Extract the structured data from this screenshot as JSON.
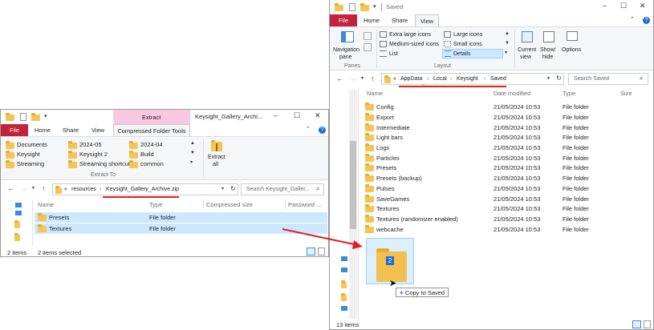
{
  "left_window": {
    "title": "Keysight_Gallery_Archi...",
    "context_tab_group": "Extract",
    "tabs": [
      "File",
      "Home",
      "Share",
      "View",
      "Compressed Folder Tools"
    ],
    "extract_to_label": "Extract To",
    "destinations": [
      [
        "Documents",
        "Keysight",
        "Streaming"
      ],
      [
        "2024-05",
        "Keysight 2",
        "Streaming shortcuts"
      ],
      [
        "2024-04",
        "Build",
        "common"
      ]
    ],
    "extract_all_label_1": "Extract",
    "extract_all_label_2": "all",
    "address": {
      "overflow": "«",
      "crumbs": [
        "resources",
        "Keysight_Gallery_Archive.zip"
      ]
    },
    "search_placeholder": "Search Keysight_Galler...",
    "columns": [
      "Name",
      "Type",
      "Compressed size",
      "Password ..."
    ],
    "rows": [
      {
        "name": "Presets",
        "type": "File folder"
      },
      {
        "name": "Textures",
        "type": "File folder"
      }
    ],
    "status_items": "2 items",
    "status_selected": "2 items selected"
  },
  "right_window": {
    "title": "Saved",
    "tabs": [
      "File",
      "Home",
      "Share",
      "View"
    ],
    "panes": {
      "nav_pane_1": "Navigation",
      "nav_pane_2": "pane",
      "group_label": "Panes"
    },
    "layout": {
      "options": [
        "Extra large icons",
        "Large icons",
        "Medium-sized icons",
        "Small icons",
        "List",
        "Details"
      ],
      "selected": "Details",
      "group_label": "Layout"
    },
    "current_view_1": "Current",
    "current_view_2": "view",
    "show_hide_1": "Show/",
    "show_hide_2": "hide",
    "options_label": "Options",
    "address": {
      "overflow": "«",
      "crumbs": [
        "AppData",
        "Local",
        "Keysight",
        "Saved"
      ]
    },
    "search_placeholder": "Search Saved",
    "columns": [
      "Name",
      "Date modified",
      "Type",
      "Size"
    ],
    "rows": [
      {
        "name": "Config",
        "date": "21/05/2024 10:53",
        "type": "File folder"
      },
      {
        "name": "Export",
        "date": "21/05/2024 10:53",
        "type": "File folder"
      },
      {
        "name": "Intermediate",
        "date": "21/05/2024 10:53",
        "type": "File folder"
      },
      {
        "name": "Light bars",
        "date": "21/05/2024 10:53",
        "type": "File folder"
      },
      {
        "name": "Logs",
        "date": "21/05/2024 10:53",
        "type": "File folder"
      },
      {
        "name": "Particles",
        "date": "21/05/2024 10:53",
        "type": "File folder"
      },
      {
        "name": "Presets",
        "date": "21/05/2024 10:53",
        "type": "File folder"
      },
      {
        "name": "Presets (backup)",
        "date": "21/05/2024 10:53",
        "type": "File folder"
      },
      {
        "name": "Pulses",
        "date": "21/05/2024 10:53",
        "type": "File folder"
      },
      {
        "name": "SaveGames",
        "date": "21/05/2024 10:53",
        "type": "File folder"
      },
      {
        "name": "Textures",
        "date": "21/05/2024 10:53",
        "type": "File folder"
      },
      {
        "name": "Textures (randomizer enabled)",
        "date": "21/05/2024 10:53",
        "type": "File folder"
      },
      {
        "name": "webcache",
        "date": "21/05/2024 10:53",
        "type": "File folder"
      }
    ],
    "status_items": "13 items"
  },
  "drag": {
    "count_badge": "2",
    "copy_tooltip": "Copy to Saved"
  },
  "colors": {
    "file_tab": "#c4213c",
    "selection": "#cce8ff",
    "context_tab": "#f9c8e0",
    "annotation_red": "#e02020",
    "folder": "#f5c452"
  }
}
